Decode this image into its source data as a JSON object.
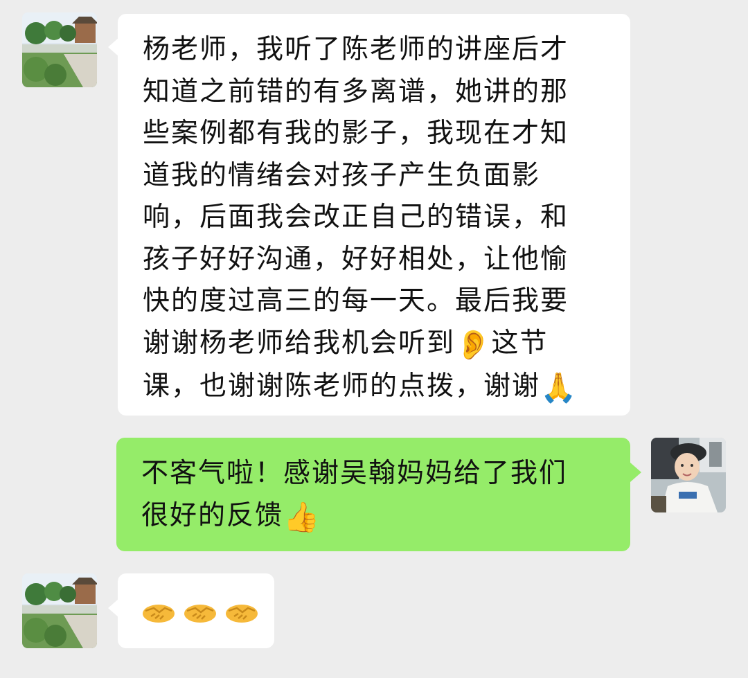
{
  "chat": {
    "messages": [
      {
        "sender": "other",
        "avatar": "garden-avatar",
        "lines": [
          "杨老师，我听了陈老师的讲座后才",
          "知道之前错的有多离谱，她讲的那",
          "些案例都有我的影子，我现在才知",
          "道我的情绪会对孩子产生负面影",
          "响，后面我会改正自己的错误，和",
          "孩子好好沟通，好好相处，让他愉",
          "快的度过高三的每一天。最后我要",
          "谢谢杨老师给我机会听到",
          "这节",
          "课，也谢谢陈老师的点拨，谢谢"
        ],
        "emojis": {
          "ear": "👂",
          "pray": "🙏"
        }
      },
      {
        "sender": "me",
        "avatar": "child-avatar",
        "lines": [
          "不客气啦！感谢吴翰妈妈给了我们",
          "很好的反馈"
        ],
        "emojis": {
          "thumbs_up": "👍"
        }
      },
      {
        "sender": "other",
        "avatar": "garden-avatar",
        "emoji_message": [
          "🤝",
          "🤝",
          "🤝"
        ]
      }
    ]
  },
  "colors": {
    "background": "#ededed",
    "incoming_bubble": "#ffffff",
    "outgoing_bubble": "#95ec69"
  }
}
